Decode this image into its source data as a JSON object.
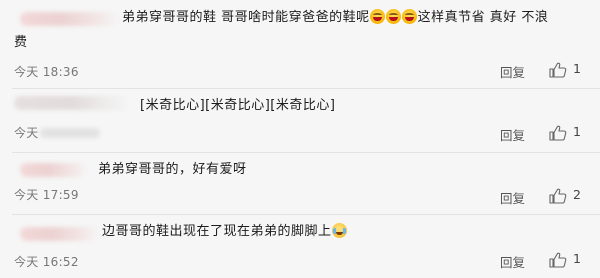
{
  "comments": [
    {
      "text_line1": "弟弟穿哥哥的鞋  哥哥啥时能穿爸爸的鞋呢",
      "text_line1_tail": "这样真节省 真好  不浪",
      "text_line2": "费",
      "time": "今天 18:36",
      "reply": "回复",
      "likes": "1",
      "emojis": [
        "laugh-emoji",
        "laugh-emoji",
        "laugh-emoji"
      ]
    },
    {
      "text": "[米奇比心][米奇比心][米奇比心]",
      "time": "今天",
      "reply": "回复",
      "likes": "1"
    },
    {
      "text": "弟弟穿哥哥的，好有爱呀",
      "time": "今天 17:59",
      "reply": "回复",
      "likes": "2"
    },
    {
      "text": "边哥哥的鞋出现在了现在弟弟的脚脚上",
      "time": "今天 16:52",
      "reply": "回复",
      "likes": "1",
      "emojis": [
        "cry-laugh-emoji"
      ]
    }
  ],
  "colors": {
    "background": "#f6f6f6",
    "text": "#1c1c1c",
    "meta": "#777777",
    "divider": "#e3e3e3"
  }
}
